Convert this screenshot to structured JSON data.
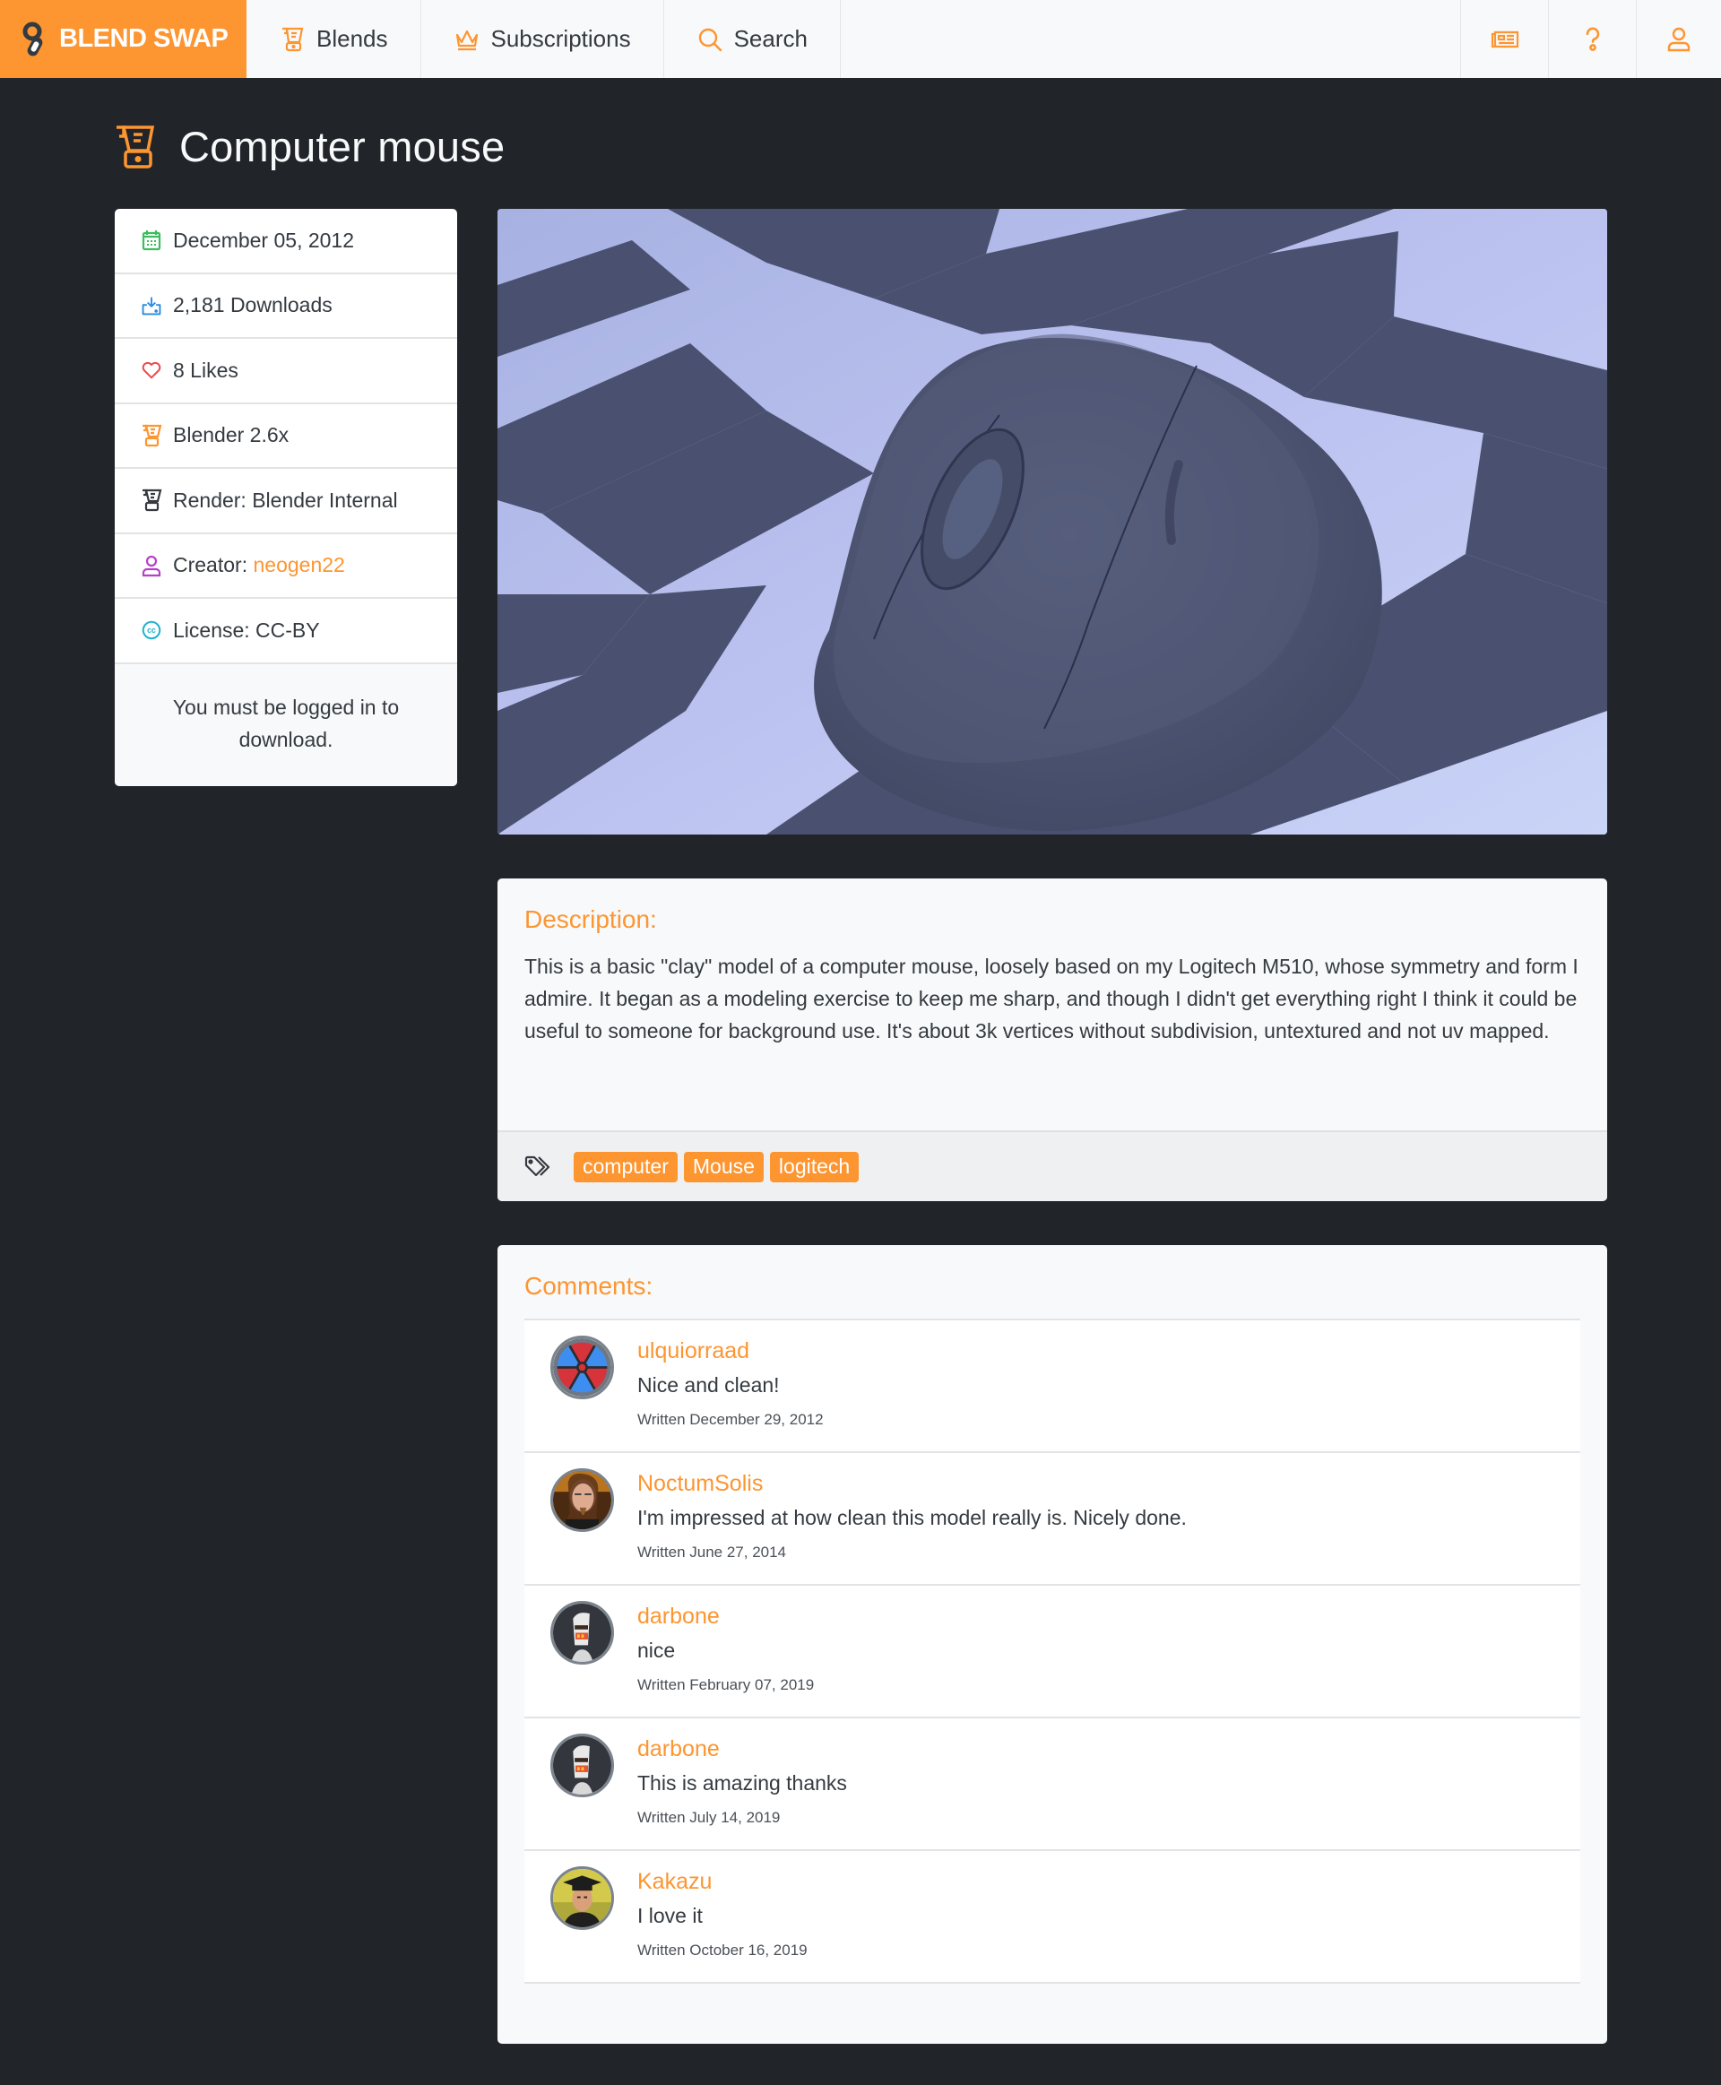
{
  "colors": {
    "accent": "#fd9530",
    "page_bg": "#212429",
    "nav_bg": "#f8f9fa",
    "card_bg": "#f8f9fa",
    "text": "#343a40",
    "date_icon": "#3dbd5d",
    "downloads_icon": "#2b8ae2",
    "likes_icon": "#ec4b4b",
    "creator_icon": "#b542c6",
    "license_icon": "#1fb3cf"
  },
  "nav": {
    "brand": "BLEND SWAP",
    "items": [
      {
        "label": "Blends",
        "icon": "blender-icon"
      },
      {
        "label": "Subscriptions",
        "icon": "crown-icon"
      },
      {
        "label": "Search",
        "icon": "search-icon"
      }
    ],
    "right_icons": [
      "newspaper-icon",
      "question-icon",
      "user-icon"
    ]
  },
  "page": {
    "title": "Computer mouse"
  },
  "sidebar": {
    "date": "December 05, 2012",
    "downloads": "2,181 Downloads",
    "likes": "8 Likes",
    "blender_version": "Blender 2.6x",
    "render": "Render: Blender Internal",
    "creator_label": "Creator: ",
    "creator_name": "neogen22",
    "license": "License: CC-BY",
    "download_notice": "You must be logged in to download."
  },
  "preview": {
    "alt": "Render of a grey clay computer mouse on a blue checkerboard floor"
  },
  "description": {
    "heading": "Description:",
    "text": "This is a basic \"clay\" model of a computer mouse, loosely based on my Logitech M510, whose symmetry and form I admire. It began as a modeling exercise to keep me sharp, and though I didn't get everything right I think it could be useful to someone for background use. It's about 3k vertices without subdivision, untextured and not uv mapped.",
    "tags": [
      "computer",
      "Mouse",
      "logitech"
    ]
  },
  "comments": {
    "heading": "Comments:",
    "items": [
      {
        "user": "ulquiorraad",
        "text": "Nice and clean!",
        "date": "Written December 29, 2012",
        "avatar": "radial-emblem"
      },
      {
        "user": "NoctumSolis",
        "text": "I'm impressed at how clean this model really is. Nicely done.",
        "date": "Written June 27, 2014",
        "avatar": "photo-portrait"
      },
      {
        "user": "darbone",
        "text": "nice",
        "date": "Written February 07, 2019",
        "avatar": "robot"
      },
      {
        "user": "darbone",
        "text": "This is amazing thanks",
        "date": "Written July 14, 2019",
        "avatar": "robot"
      },
      {
        "user": "Kakazu",
        "text": "I love it",
        "date": "Written October 16, 2019",
        "avatar": "graduate-portrait"
      }
    ]
  }
}
